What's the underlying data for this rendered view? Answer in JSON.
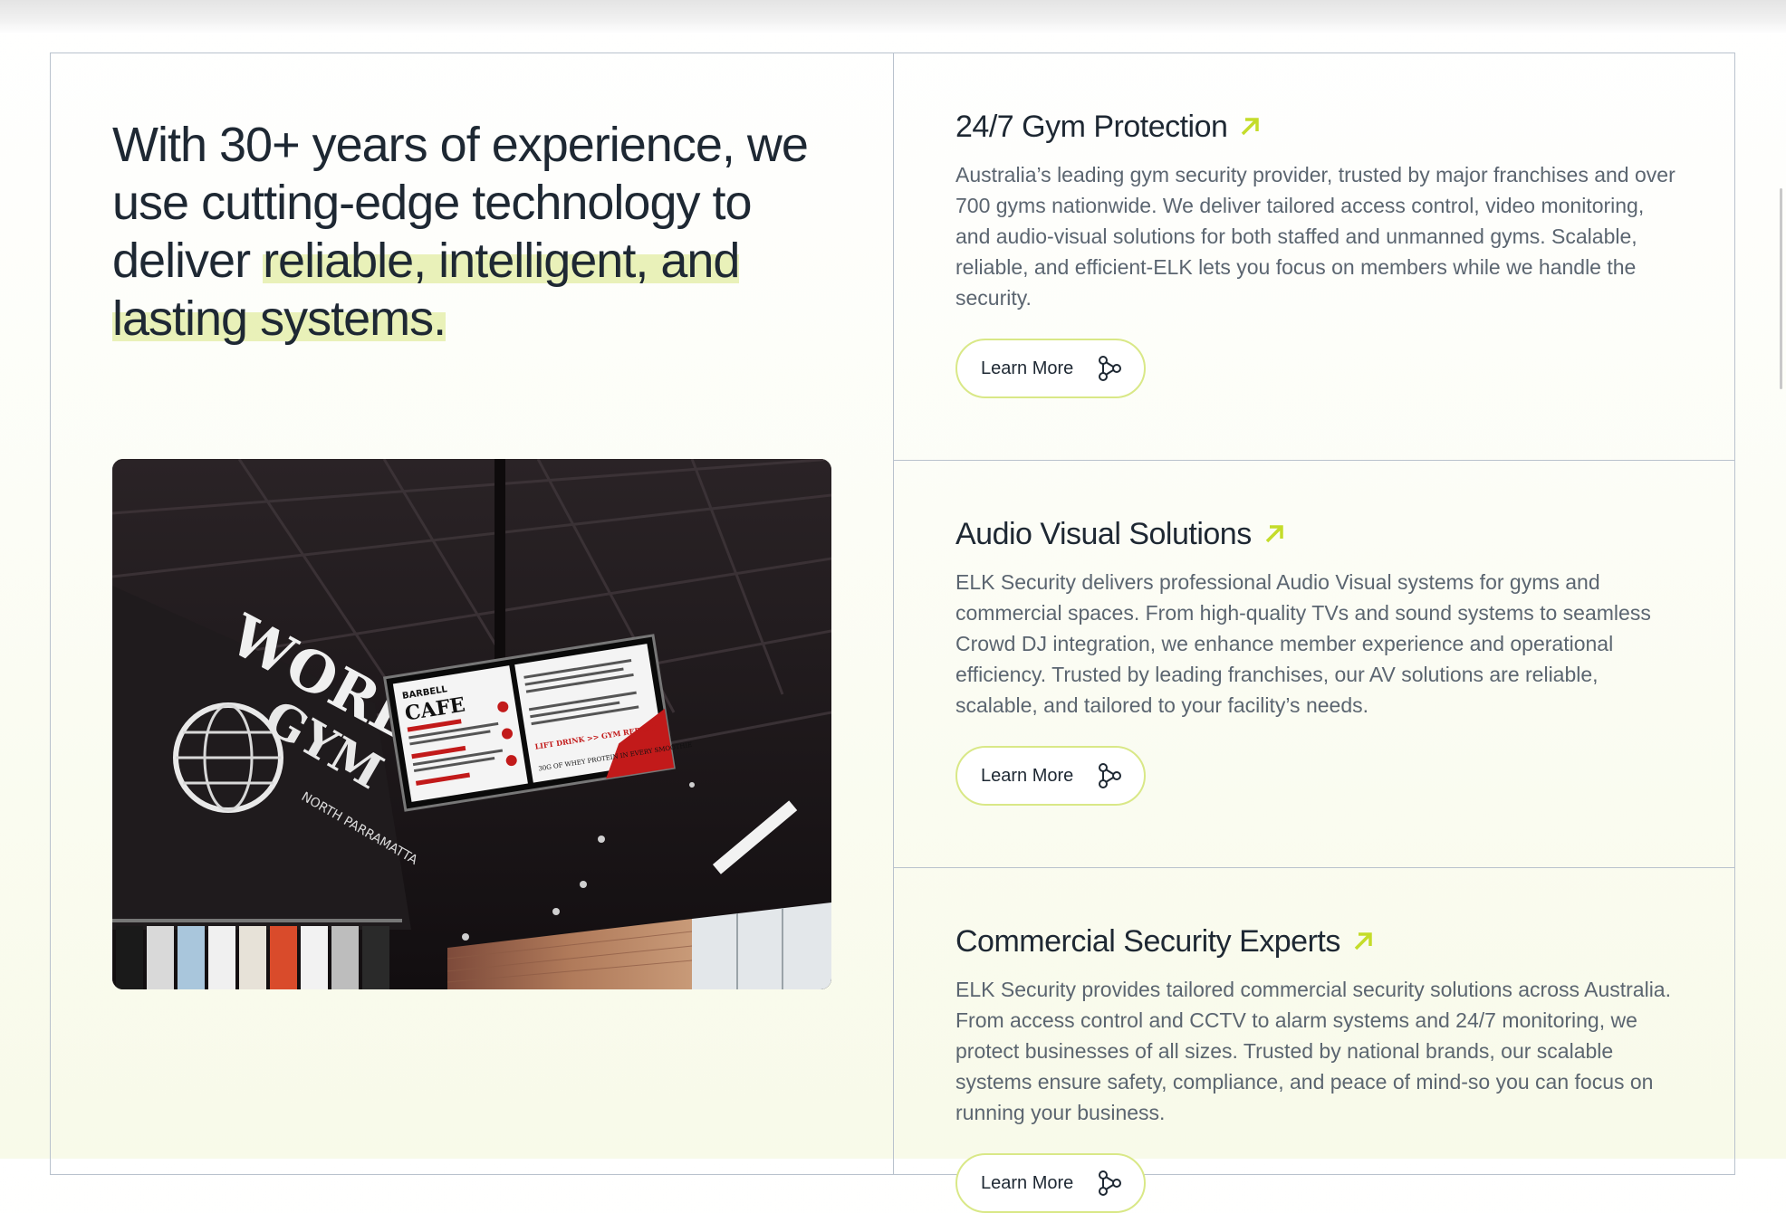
{
  "intro": {
    "headline_plain": "With 30+ years of experience, we use cutting-edge technology to deliver ",
    "headline_highlight": "reliable, intelligent, and lasting systems."
  },
  "photo": {
    "sign_world": "WORLD",
    "sign_gym": "GYM",
    "sign_location": "NORTH PARRAMATTA",
    "menu_brand": "BARBELL",
    "menu_title": "CAFE",
    "menu_promo": "LIFT DRINK >> GYM REPEAT",
    "menu_promo2": "30G OF WHEY PROTEIN IN EVERY SMOOTHIE"
  },
  "services": [
    {
      "title": "24/7 Gym Protection",
      "description": "Australia’s leading gym security provider, trusted by major franchises and over 700 gyms nationwide. We deliver tailored access control, video monitoring, and audio-visual solutions for both staffed and unmanned gyms. Scalable, reliable, and efficient-ELK lets you focus on members while we handle the security.",
      "button": "Learn More"
    },
    {
      "title": "Audio Visual Solutions",
      "description": "ELK Security delivers professional Audio Visual systems for gyms and commercial spaces. From high-quality TVs and sound systems to seamless Crowd DJ integration, we enhance member experience and operational efficiency. Trusted by leading franchises, our AV solutions are reliable, scalable, and tailored to your facility’s needs.",
      "button": "Learn More"
    },
    {
      "title": "Commercial Security Experts",
      "description": "ELK Security provides tailored commercial security solutions across Australia. From access control and CCTV to alarm systems and 24/7 monitoring, we protect businesses of all sizes. Trusted by national brands, our scalable systems ensure safety, compliance, and peace of mind-so you can focus on running your business.",
      "button": "Learn More"
    }
  ],
  "colors": {
    "accent": "#c4dc2a",
    "heading": "#1e2833",
    "body": "#5b6570",
    "border": "#b9c2cd",
    "highlight": "#deea96"
  },
  "icons": {
    "title_arrow": "arrow-up-right-icon",
    "button_icon": "share-nodes-icon"
  }
}
